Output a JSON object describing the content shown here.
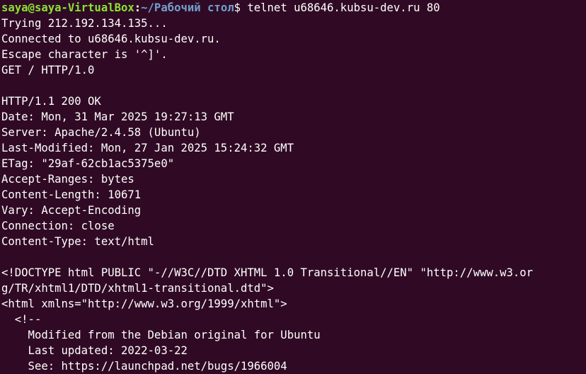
{
  "prompt": {
    "user_host": "saya@saya-VirtualBox",
    "separator": ":",
    "path": "~/Рабочий стол",
    "sign": "$",
    "command": " telnet u68646.kubsu-dev.ru 80"
  },
  "output_lines": [
    "Trying 212.192.134.135...",
    "Connected to u68646.kubsu-dev.ru.",
    "Escape character is '^]'.",
    "GET / HTTP/1.0",
    "",
    "HTTP/1.1 200 OK",
    "Date: Mon, 31 Mar 2025 19:27:13 GMT",
    "Server: Apache/2.4.58 (Ubuntu)",
    "Last-Modified: Mon, 27 Jan 2025 15:24:32 GMT",
    "ETag: \"29af-62cb1ac5375e0\"",
    "Accept-Ranges: bytes",
    "Content-Length: 10671",
    "Vary: Accept-Encoding",
    "Connection: close",
    "Content-Type: text/html",
    "",
    "<!DOCTYPE html PUBLIC \"-//W3C//DTD XHTML 1.0 Transitional//EN\" \"http://www.w3.or",
    "g/TR/xhtml1/DTD/xhtml1-transitional.dtd\">",
    "<html xmlns=\"http://www.w3.org/1999/xhtml\">",
    "  <!--",
    "    Modified from the Debian original for Ubuntu",
    "    Last updated: 2022-03-22",
    "    See: https://launchpad.net/bugs/1966004"
  ]
}
